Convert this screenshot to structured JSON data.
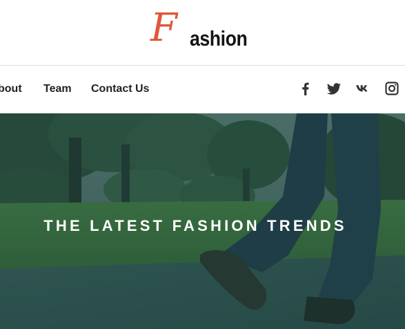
{
  "brand": {
    "logo_letter": "F",
    "logo_word": "ashion",
    "accent_color": "#e0573a"
  },
  "nav": {
    "items": [
      {
        "label": "bout"
      },
      {
        "label": "Team"
      },
      {
        "label": "Contact Us"
      }
    ],
    "social": [
      {
        "icon": "facebook-icon"
      },
      {
        "icon": "twitter-icon"
      },
      {
        "icon": "vk-icon"
      },
      {
        "icon": "instagram-icon"
      }
    ]
  },
  "hero": {
    "title": "THE LATEST FASHION TRENDS",
    "overlay_color": "#1f4a44"
  }
}
